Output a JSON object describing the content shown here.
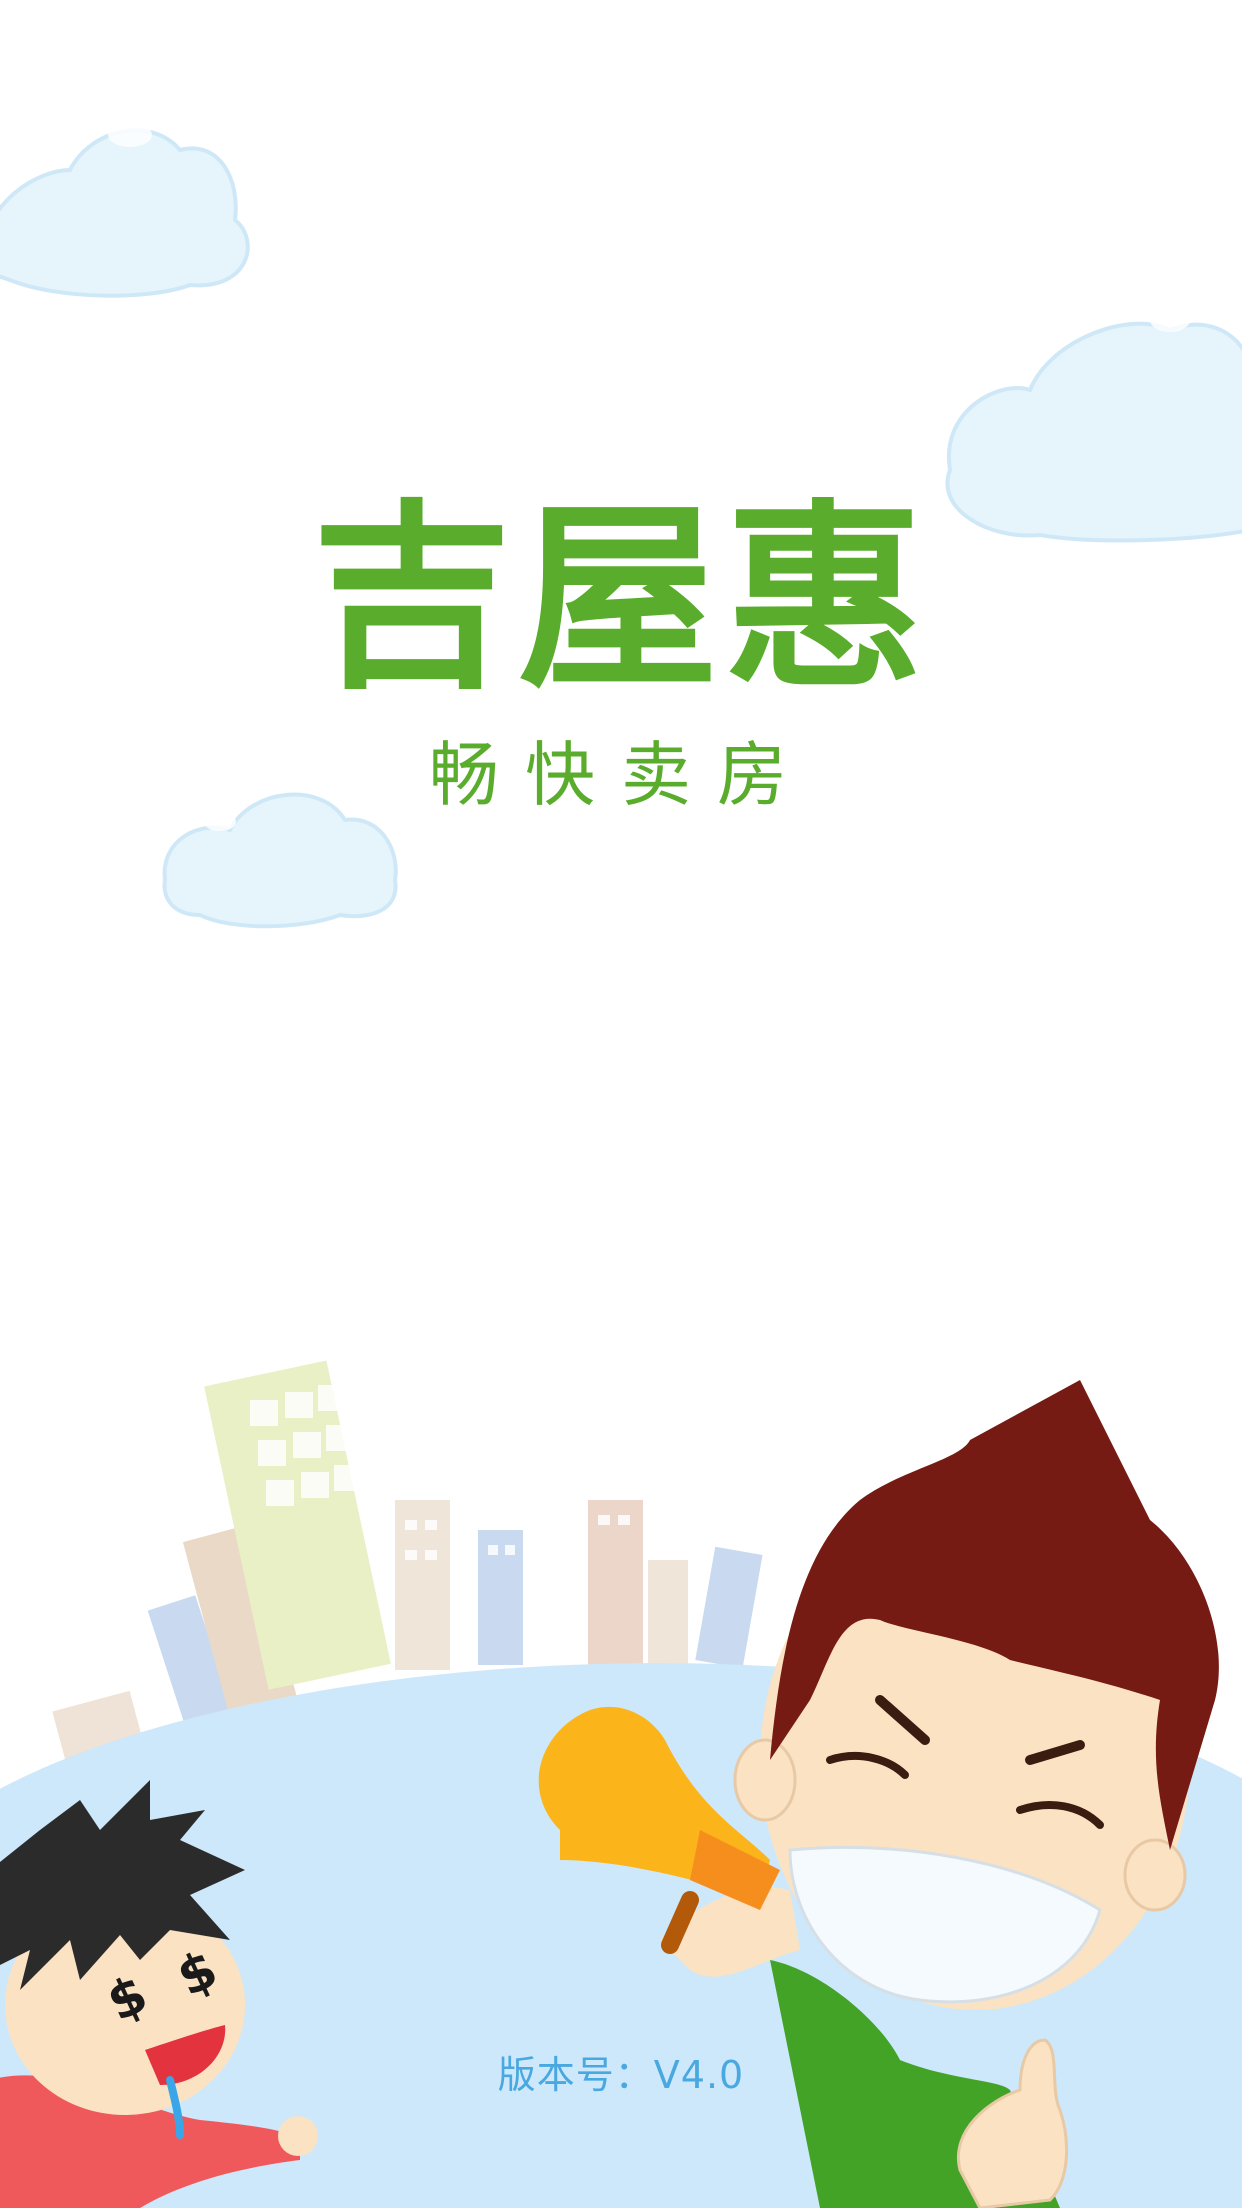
{
  "splash": {
    "brand_title": "吉屋惠",
    "slogan": "畅快卖房",
    "version_label": "版本号：V4.0"
  },
  "colors": {
    "brand_green": "#5aad2c",
    "version_blue": "#4aa8e0",
    "cloud": "#e6f4fc",
    "ground": "#cce8fa"
  },
  "illustration": {
    "icons": [
      "cloud-icon",
      "city-skyline",
      "boy-with-megaphone",
      "boy-with-dollar-eyes"
    ]
  }
}
